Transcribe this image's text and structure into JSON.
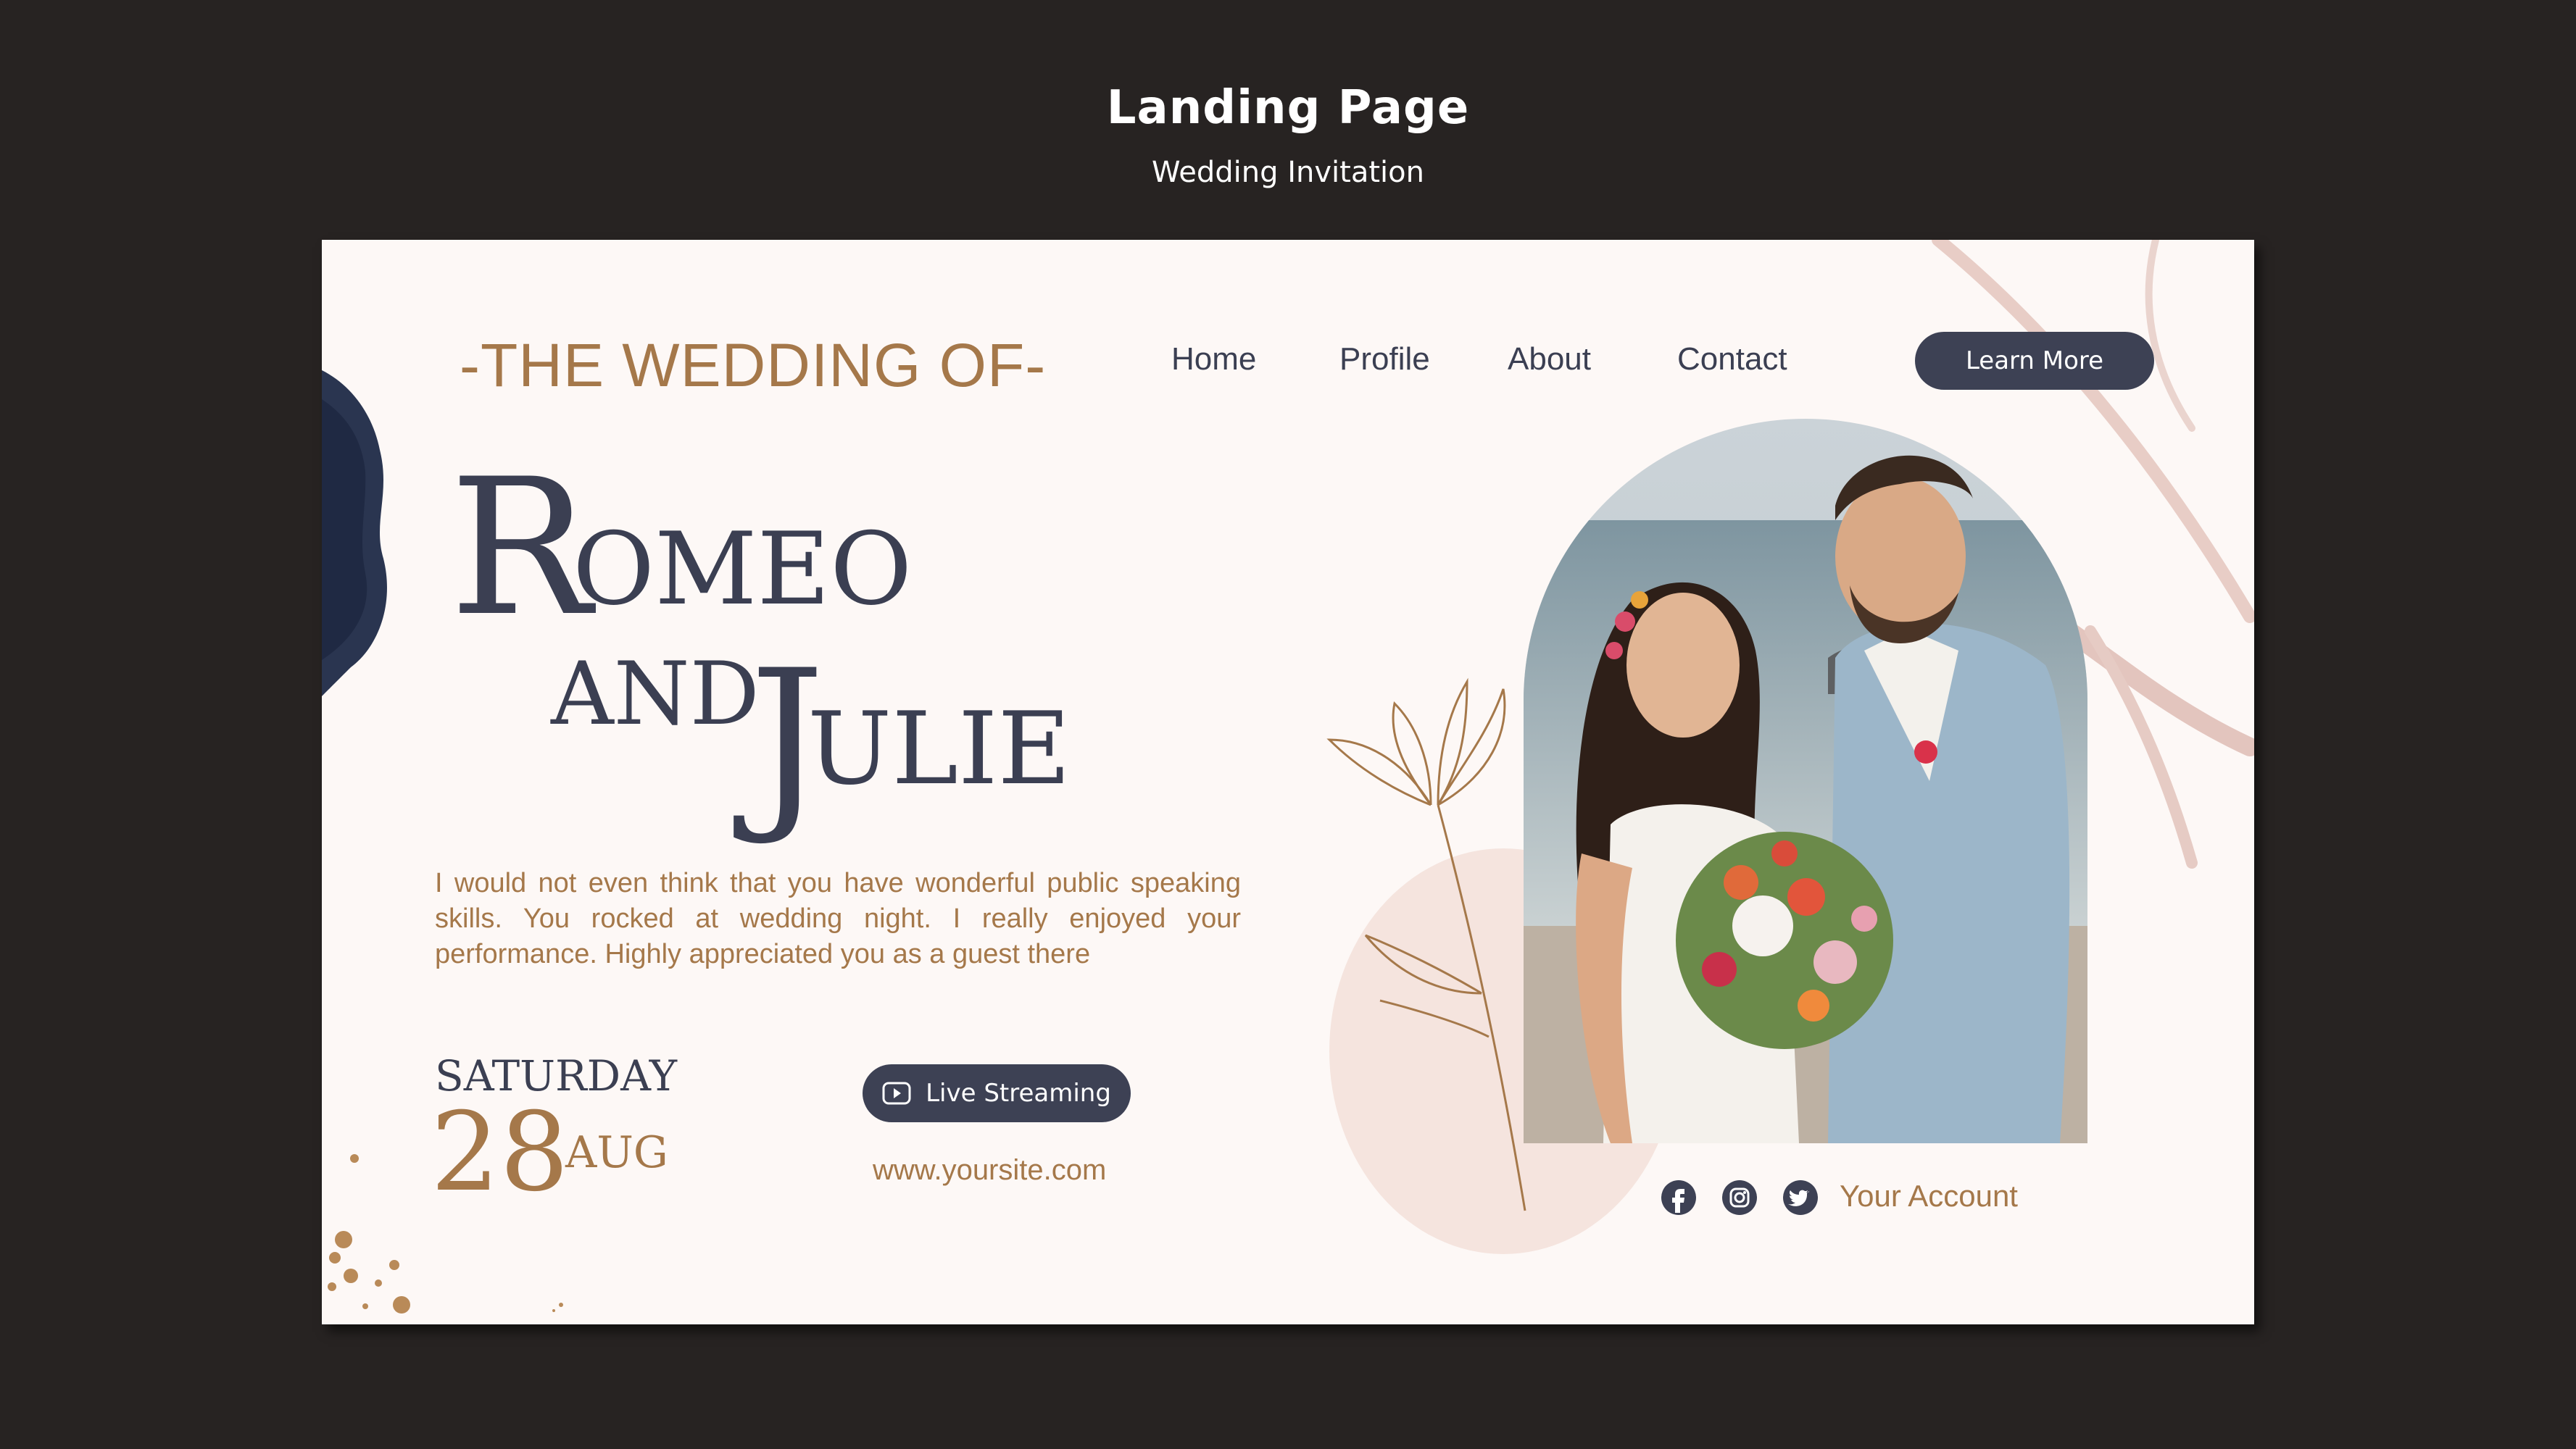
{
  "header": {
    "title": "Landing Page",
    "subtitle": "Wedding Invitation"
  },
  "nav": {
    "brand": "-THE WEDDING OF-",
    "items": [
      {
        "label": "Home"
      },
      {
        "label": "Profile"
      },
      {
        "label": "About"
      },
      {
        "label": "Contact"
      }
    ],
    "cta": "Learn More"
  },
  "hero": {
    "name1_initial": "R",
    "name1_rest": "OMEO",
    "and": "AND",
    "name2_initial": "J",
    "name2_rest": "ULIE",
    "message": "I would not even think that you have wonderful public speaking skills. You rocked at wedding night. I really enjoyed your performance. Highly appreciated you as a guest there"
  },
  "date": {
    "weekday": "SATURDAY",
    "day": "28",
    "month": "AUG"
  },
  "stream": {
    "label": "Live Streaming",
    "website": "www.yoursite.com"
  },
  "social": {
    "icons": [
      "facebook-icon",
      "instagram-icon",
      "twitter-icon"
    ],
    "account_label": "Your Account"
  },
  "colors": {
    "page_bg": "#272322",
    "card_bg": "#fdf8f6",
    "accent_gold": "#a5784a",
    "navy": "#3d4154"
  }
}
